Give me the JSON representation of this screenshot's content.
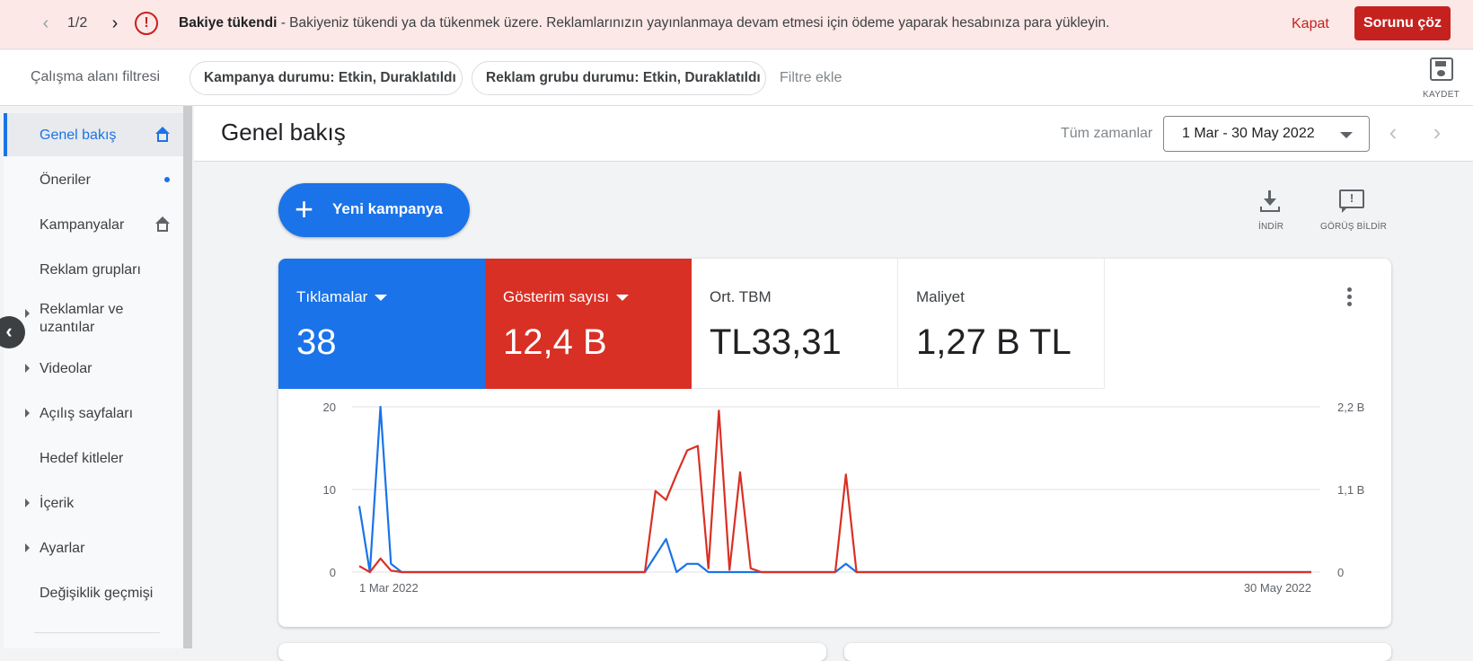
{
  "banner": {
    "pager": "1/2",
    "title": "Bakiye tükendi",
    "message": " - Bakiyeniz tükendi ya da tükenmek üzere. Reklamlarınızın yayınlanmaya devam etmesi için ödeme yaparak hesabınıza para yükleyin.",
    "close_label": "Kapat",
    "fix_label": "Sorunu çöz"
  },
  "filters": {
    "label": "Çalışma alanı filtresi",
    "chips": [
      "Kampanya durumu: Etkin, Duraklatıldı",
      "Reklam grubu durumu: Etkin, Duraklatıldı"
    ],
    "add_label": "Filtre ekle",
    "save_label": "KAYDET"
  },
  "sidebar": {
    "items": [
      {
        "label": "Genel bakış",
        "active": true,
        "icon": "home-icon"
      },
      {
        "label": "Öneriler",
        "icon": "dot-icon"
      },
      {
        "label": "Kampanyalar",
        "icon": "home-icon"
      },
      {
        "label": "Reklam grupları"
      },
      {
        "label": "Reklamlar ve uzantılar",
        "expandable": true
      },
      {
        "label": "Videolar",
        "expandable": true
      },
      {
        "label": "Açılış sayfaları",
        "expandable": true
      },
      {
        "label": "Hedef kitleler"
      },
      {
        "label": "İçerik",
        "expandable": true
      },
      {
        "label": "Ayarlar",
        "expandable": true
      },
      {
        "label": "Değişiklik geçmişi"
      }
    ]
  },
  "header": {
    "title": "Genel bakış",
    "range_label": "Tüm zamanlar",
    "date_range": "1 Mar - 30 May 2022"
  },
  "actions": {
    "new_campaign": "Yeni kampanya",
    "download_label": "İNDİR",
    "feedback_label": "GÖRÜŞ BİLDİR"
  },
  "metrics": [
    {
      "name": "Tıklamalar",
      "value": "38",
      "color": "#1a73e8"
    },
    {
      "name": "Gösterim sayısı",
      "value": "12,4 B",
      "color": "#d93025"
    },
    {
      "name": "Ort. TBM",
      "value": "TL33,31"
    },
    {
      "name": "Maliyet",
      "value": "1,27 B TL"
    }
  ],
  "chart_data": {
    "type": "line",
    "x_start_label": "1 Mar 2022",
    "x_end_label": "30 May 2022",
    "points": 91,
    "left_axis": {
      "ticks": [
        "0",
        "10",
        "20"
      ],
      "range": [
        0,
        20
      ]
    },
    "right_axis": {
      "ticks": [
        "0",
        "1,1 B",
        "2,2 B"
      ],
      "range": [
        0,
        2.2
      ]
    },
    "series": [
      {
        "name": "Tıklamalar",
        "color": "#1a73e8",
        "axis": "left",
        "values": [
          8,
          0,
          20,
          1,
          0,
          0,
          0,
          0,
          0,
          0,
          0,
          0,
          0,
          0,
          0,
          0,
          0,
          0,
          0,
          0,
          0,
          0,
          0,
          0,
          0,
          0,
          0,
          0,
          2,
          4,
          0,
          1,
          1,
          0,
          0,
          0,
          0,
          0,
          0,
          0,
          0,
          0,
          0,
          0,
          0,
          0,
          1,
          0,
          0,
          0,
          0,
          0,
          0,
          0,
          0,
          0,
          0,
          0,
          0,
          0,
          0,
          0,
          0,
          0,
          0,
          0,
          0,
          0,
          0,
          0,
          0,
          0,
          0,
          0,
          0,
          0,
          0,
          0,
          0,
          0,
          0,
          0,
          0,
          0,
          0,
          0,
          0,
          0,
          0,
          0,
          0
        ]
      },
      {
        "name": "Gösterim sayısı",
        "color": "#d93025",
        "axis": "right",
        "values": [
          0.08,
          0,
          0.18,
          0.02,
          0,
          0,
          0,
          0,
          0,
          0,
          0,
          0,
          0,
          0,
          0,
          0,
          0,
          0,
          0,
          0,
          0,
          0,
          0,
          0,
          0,
          0,
          0,
          0,
          1.08,
          0.96,
          1.3,
          1.62,
          1.68,
          0.05,
          2.15,
          0.03,
          1.33,
          0.05,
          0,
          0,
          0,
          0,
          0,
          0,
          0,
          0,
          1.3,
          0,
          0,
          0,
          0,
          0,
          0,
          0,
          0,
          0,
          0,
          0,
          0,
          0,
          0,
          0,
          0,
          0,
          0,
          0,
          0,
          0,
          0,
          0,
          0,
          0,
          0,
          0,
          0,
          0,
          0,
          0,
          0,
          0,
          0,
          0,
          0,
          0,
          0,
          0,
          0,
          0,
          0,
          0,
          0
        ]
      }
    ]
  }
}
